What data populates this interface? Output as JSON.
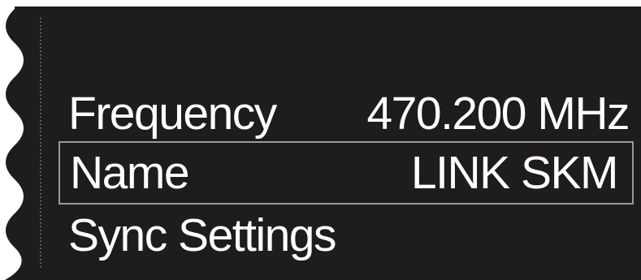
{
  "display": {
    "background_color": "#1e1c1c",
    "text_color": "#ffffff",
    "highlight_border_color": "#9a9a9a"
  },
  "menu": {
    "items": [
      {
        "label": "Frequency",
        "value": "470.200 MHz",
        "selected": false
      },
      {
        "label": "Name",
        "value": "LINK SKM",
        "selected": true
      },
      {
        "label": "Sync Settings",
        "value": "",
        "selected": false
      }
    ]
  }
}
